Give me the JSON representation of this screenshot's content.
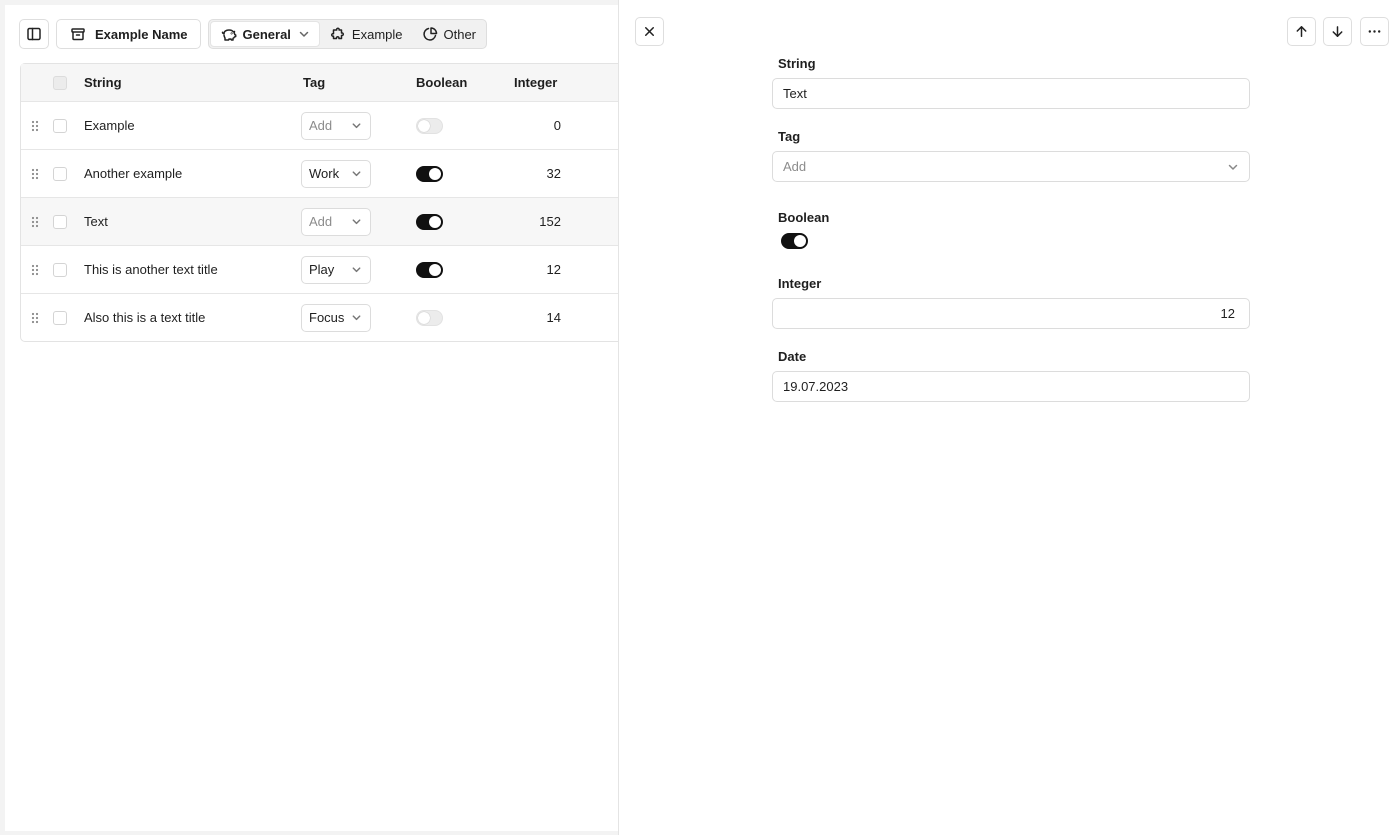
{
  "toolbar": {
    "database_name": "Example Name",
    "views": [
      {
        "label": "General",
        "icon": "piggy-bank-icon",
        "active": true
      },
      {
        "label": "Example",
        "icon": "puzzle-icon",
        "active": false
      },
      {
        "label": "Other",
        "icon": "pie-chart-icon",
        "active": false
      }
    ]
  },
  "table": {
    "columns": {
      "string": "String",
      "tag": "Tag",
      "boolean": "Boolean",
      "integer": "Integer"
    },
    "rows": [
      {
        "string": "Example",
        "tag": "Add",
        "tag_is_placeholder": true,
        "boolean": false,
        "integer": "0"
      },
      {
        "string": "Another example",
        "tag": "Work",
        "tag_is_placeholder": false,
        "boolean": true,
        "integer": "32"
      },
      {
        "string": "Text",
        "tag": "Add",
        "tag_is_placeholder": true,
        "boolean": true,
        "integer": "152"
      },
      {
        "string": "This is another text title",
        "tag": "Play",
        "tag_is_placeholder": false,
        "boolean": true,
        "integer": "12"
      },
      {
        "string": "Also this is a text title",
        "tag": "Focus",
        "tag_is_placeholder": false,
        "boolean": false,
        "integer": "14"
      }
    ]
  },
  "detail": {
    "string_label": "String",
    "string_value": "Text",
    "tag_label": "Tag",
    "tag_placeholder": "Add",
    "boolean_label": "Boolean",
    "boolean_value": true,
    "integer_label": "Integer",
    "integer_value": "12",
    "date_label": "Date",
    "date_value": "19.07.2023"
  },
  "colors": {
    "toggle_on": "#111111",
    "toggle_off": "#ececec",
    "border": "#dedede",
    "highlight_row": "#f7f7f7"
  }
}
